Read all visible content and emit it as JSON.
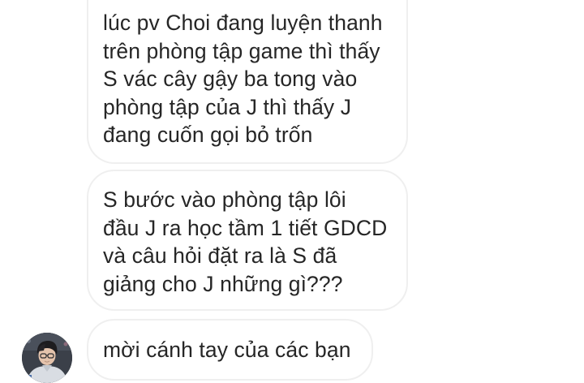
{
  "conversation": {
    "messages": [
      {
        "lines": [
          "lúc pv Choi đang luyện thanh",
          "trên phòng tập game thì thấy",
          "S vác cây gậy ba tong vào",
          "phòng tập của J thì thấy J",
          "đang cuốn gọi bỏ trốn"
        ]
      },
      {
        "lines": [
          "S bước vào phòng tập lôi",
          "đầu J ra học tầm 1 tiết GDCD",
          "và câu hỏi đặt ra là S đã",
          "giảng cho J những gì???"
        ]
      },
      {
        "lines": [
          "mời cánh tay của các bạn"
        ]
      }
    ]
  },
  "colors": {
    "background": "#ffffff",
    "bubble_border": "#efefef",
    "text": "#262626"
  },
  "icons": {
    "avatar": "sender-profile-photo"
  }
}
